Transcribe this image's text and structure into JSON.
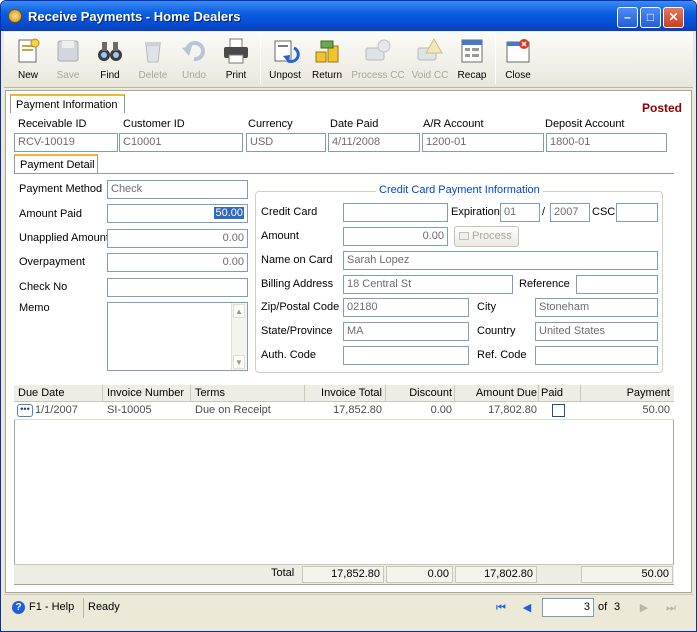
{
  "window": {
    "title": "Receive Payments - Home Dealers"
  },
  "toolbar": {
    "new": "New",
    "save": "Save",
    "find": "Find",
    "delete": "Delete",
    "undo": "Undo",
    "print": "Print",
    "unpost": "Unpost",
    "return": "Return",
    "process_cc": "Process CC",
    "void_cc": "Void CC",
    "recap": "Recap",
    "close": "Close"
  },
  "tabs": {
    "payment_information": "Payment Information",
    "payment_detail": "Payment Detail"
  },
  "status_badge": "Posted",
  "header": {
    "receivable_id_label": "Receivable ID",
    "receivable_id": "RCV-10019",
    "customer_id_label": "Customer ID",
    "customer_id": "C10001",
    "currency_label": "Currency",
    "currency": "USD",
    "date_paid_label": "Date Paid",
    "date_paid": "4/11/2008",
    "ar_account_label": "A/R Account",
    "ar_account": "1200-01",
    "deposit_account_label": "Deposit Account",
    "deposit_account": "1800-01"
  },
  "detail": {
    "payment_method_label": "Payment Method",
    "payment_method": "Check",
    "amount_paid_label": "Amount Paid",
    "amount_paid": "50.00",
    "unapplied_amount_label": "Unapplied Amount",
    "unapplied_amount": "0.00",
    "overpayment_label": "Overpayment",
    "overpayment": "0.00",
    "check_no_label": "Check No",
    "check_no": "",
    "memo_label": "Memo",
    "memo": ""
  },
  "credit_card": {
    "group_title": "Credit Card Payment Information",
    "credit_card_label": "Credit Card",
    "credit_card": "",
    "expiration_label": "Expiration",
    "exp_month": "01",
    "exp_sep": "/",
    "exp_year": "2007",
    "csc_label": "CSC",
    "csc": "",
    "amount_label": "Amount",
    "amount": "0.00",
    "process_label": "Process",
    "name_on_card_label": "Name on Card",
    "name_on_card": "Sarah  Lopez",
    "billing_address_label": "Billing Address",
    "billing_address": "18 Central St",
    "reference_label": "Reference",
    "reference": "",
    "zip_label": "Zip/Postal Code",
    "zip": "02180",
    "city_label": "City",
    "city": "Stoneham",
    "state_label": "State/Province",
    "state": "MA",
    "country_label": "Country",
    "country": "United States",
    "auth_code_label": "Auth. Code",
    "auth_code": "",
    "ref_code_label": "Ref. Code",
    "ref_code": ""
  },
  "grid": {
    "columns": [
      "Due Date",
      "Invoice Number",
      "Terms",
      "Invoice Total",
      "Discount",
      "Amount Due",
      "Paid",
      "Payment"
    ],
    "rows": [
      {
        "due_date": "1/1/2007",
        "invoice_number": "SI-10005",
        "terms": "Due on Receipt",
        "invoice_total": "17,852.80",
        "discount": "0.00",
        "amount_due": "17,802.80",
        "paid": false,
        "payment": "50.00"
      }
    ],
    "totals": {
      "label": "Total",
      "invoice_total": "17,852.80",
      "discount": "0.00",
      "amount_due": "17,802.80",
      "payment": "50.00"
    }
  },
  "statusbar": {
    "help": "F1 - Help",
    "status": "Ready",
    "page": "3",
    "of_label": "of",
    "total_pages": "3"
  },
  "colors": {
    "title_bar": "#0a5fe0",
    "posted": "#8c0000",
    "group_title": "#0046d5",
    "tab_highlight": "#f3b633"
  }
}
